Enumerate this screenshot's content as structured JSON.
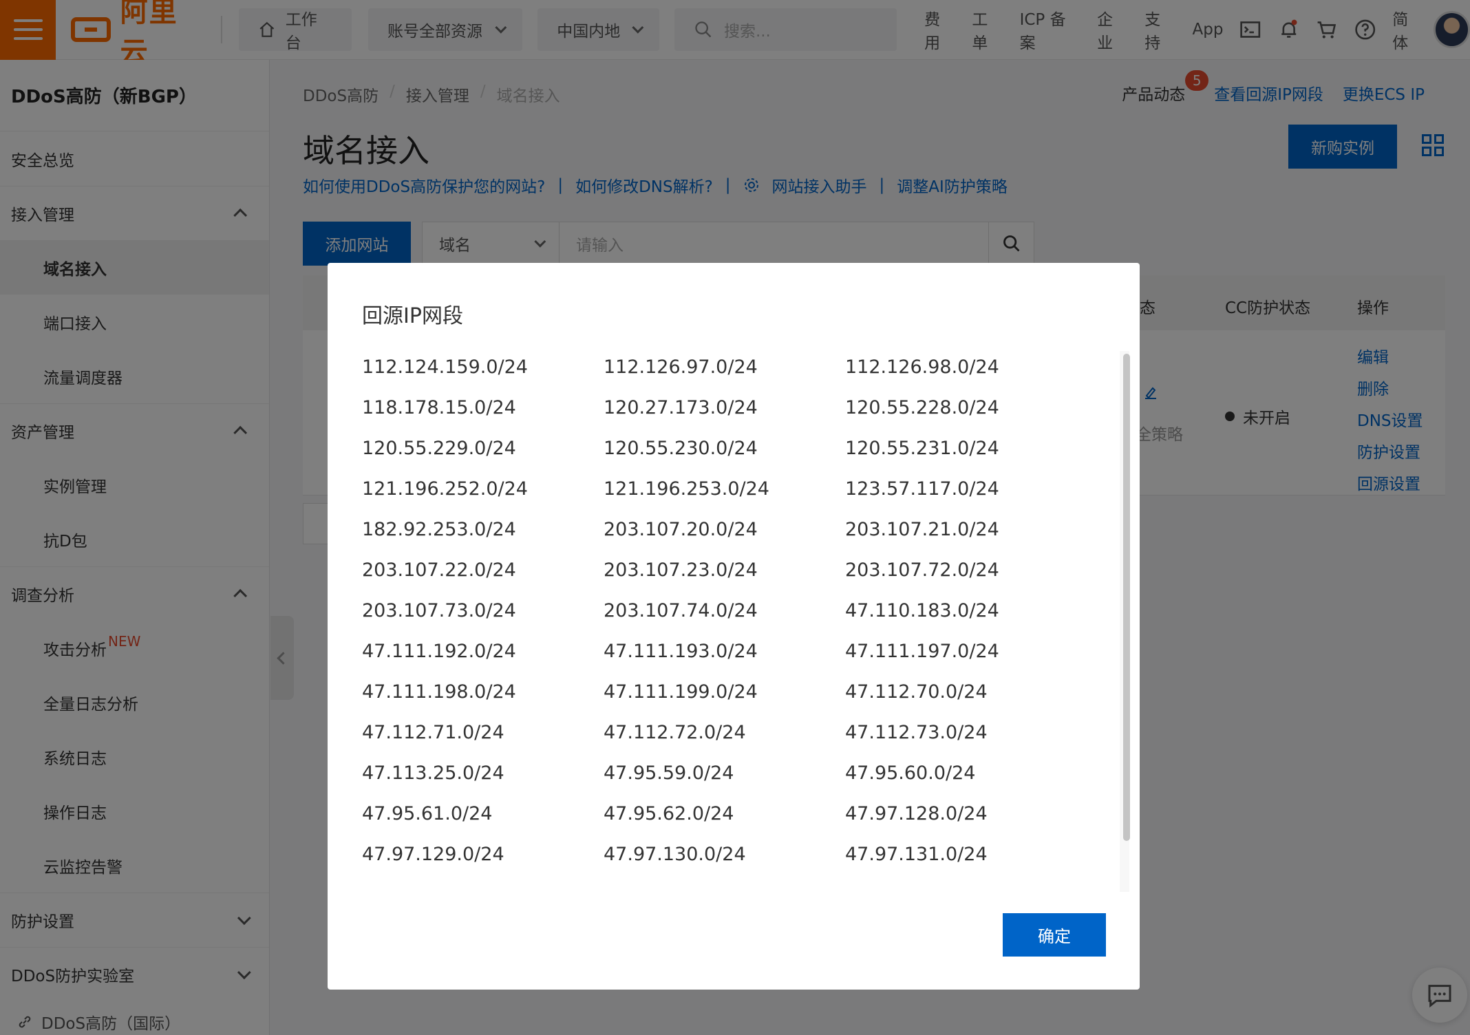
{
  "topbar": {
    "workbench": "工作台",
    "account": "账号全部资源",
    "region": "中国内地",
    "search_placeholder": "搜索...",
    "links": [
      "费用",
      "工单",
      "ICP 备案",
      "企业",
      "支持",
      "App"
    ],
    "language": "简体",
    "brand_color": "#ff6a00"
  },
  "sidebar": {
    "title": "DDoS高防（新BGP）",
    "overview": "安全总览",
    "access_group": "接入管理",
    "access_items": [
      "域名接入",
      "端口接入",
      "流量调度器"
    ],
    "asset_group": "资产管理",
    "asset_items": [
      "实例管理",
      "抗D包"
    ],
    "analysis_group": "调查分析",
    "analysis_items": [
      "攻击分析",
      "全量日志分析",
      "系统日志",
      "操作日志",
      "云监控告警"
    ],
    "new_badge": "NEW",
    "protect_group": "防护设置",
    "lab_group": "DDoS防护实验室",
    "external_link": "DDoS高防（国际）"
  },
  "main": {
    "breadcrumb": [
      "DDoS高防",
      "接入管理",
      "域名接入"
    ],
    "news_label": "产品动态",
    "news_count": "5",
    "link_ip_range": "查看回源IP网段",
    "link_change_ecs": "更换ECS IP",
    "title": "域名接入",
    "buy_button": "新购实例",
    "help_links": [
      "如何使用DDoS高防保护您的网站?",
      "如何修改DNS解析?",
      "网站接入助手",
      "调整AI防护策略"
    ],
    "add_site_button": "添加网站",
    "filter_select": "域名",
    "filter_placeholder": "请输入",
    "columns": {
      "status_tail": "态",
      "cc_status": "CC防护状态",
      "ops": "操作"
    },
    "row": {
      "strategy_tail": "全策略",
      "cc_value": "未开启",
      "ops": [
        "编辑",
        "删除",
        "DNS设置",
        "防护设置",
        "回源设置"
      ]
    },
    "primary_color": "#0064c8"
  },
  "modal": {
    "title": "回源IP网段",
    "ips": [
      "112.124.159.0/24",
      "112.126.97.0/24",
      "112.126.98.0/24",
      "118.178.15.0/24",
      "120.27.173.0/24",
      "120.55.228.0/24",
      "120.55.229.0/24",
      "120.55.230.0/24",
      "120.55.231.0/24",
      "121.196.252.0/24",
      "121.196.253.0/24",
      "123.57.117.0/24",
      "182.92.253.0/24",
      "203.107.20.0/24",
      "203.107.21.0/24",
      "203.107.22.0/24",
      "203.107.23.0/24",
      "203.107.72.0/24",
      "203.107.73.0/24",
      "203.107.74.0/24",
      "47.110.183.0/24",
      "47.111.192.0/24",
      "47.111.193.0/24",
      "47.111.197.0/24",
      "47.111.198.0/24",
      "47.111.199.0/24",
      "47.112.70.0/24",
      "47.112.71.0/24",
      "47.112.72.0/24",
      "47.112.73.0/24",
      "47.113.25.0/24",
      "47.95.59.0/24",
      "47.95.60.0/24",
      "47.95.61.0/24",
      "47.95.62.0/24",
      "47.97.128.0/24",
      "47.97.129.0/24",
      "47.97.130.0/24",
      "47.97.131.0/24"
    ],
    "confirm_button": "确定"
  }
}
